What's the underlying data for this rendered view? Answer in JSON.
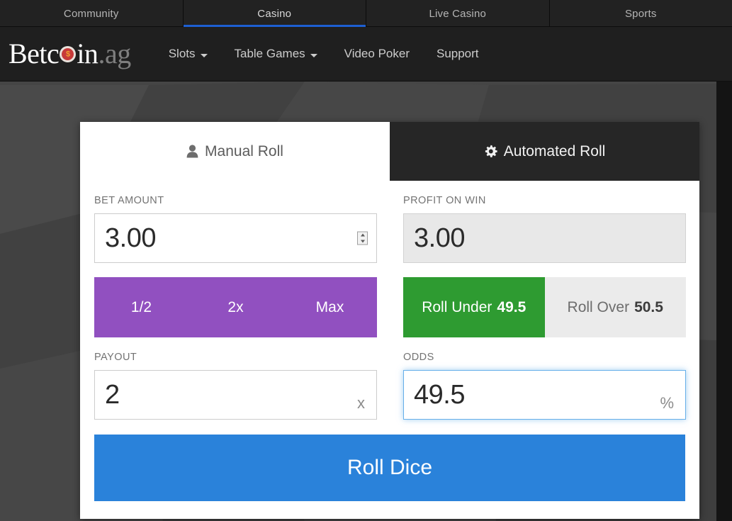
{
  "top_tabs": [
    {
      "label": "Community",
      "active": false
    },
    {
      "label": "Casino",
      "active": true
    },
    {
      "label": "Live Casino",
      "active": false
    },
    {
      "label": "Sports",
      "active": false
    }
  ],
  "brand": {
    "text_a": "Betc",
    "chip_symbol": "$",
    "text_b": "in",
    "tld": ".ag"
  },
  "main_nav": [
    {
      "label": "Slots",
      "caret": true
    },
    {
      "label": "Table Games",
      "caret": true
    },
    {
      "label": "Video Poker",
      "caret": false
    },
    {
      "label": "Support",
      "caret": false
    }
  ],
  "card": {
    "tabs": [
      {
        "label": "Manual Roll",
        "icon": "user-icon",
        "glyph": "👤",
        "active": true
      },
      {
        "label": "Automated Roll",
        "icon": "gear-icon",
        "glyph": "⚙",
        "active": false
      }
    ],
    "bet_amount": {
      "label": "BET AMOUNT",
      "value": "3.00",
      "readonly": false,
      "spinner": true
    },
    "profit_on_win": {
      "label": "PROFIT ON WIN",
      "value": "3.00",
      "readonly": true
    },
    "multiplier_buttons": [
      {
        "label": "1/2"
      },
      {
        "label": "2x"
      },
      {
        "label": "Max"
      }
    ],
    "roll_direction": [
      {
        "label": "Roll Under",
        "value": "49.5",
        "active": true
      },
      {
        "label": "Roll Over",
        "value": "50.5",
        "active": false
      }
    ],
    "payout": {
      "label": "PAYOUT",
      "value": "2",
      "suffix": "x",
      "focused": false
    },
    "odds": {
      "label": "ODDS",
      "value": "49.5",
      "suffix": "%",
      "focused": true
    },
    "submit": {
      "label": "Roll Dice"
    }
  },
  "colors": {
    "accent_blue": "#2a82da",
    "tab_underline": "#1d5fd2",
    "purple": "#9150c0",
    "green": "#2e9b31",
    "inactive_gray": "#ebebeb",
    "page_bg": "#454545",
    "navbar_bg": "#1f1f1f",
    "topbar_bg": "#222222",
    "focus_blue": "#66afe9"
  }
}
